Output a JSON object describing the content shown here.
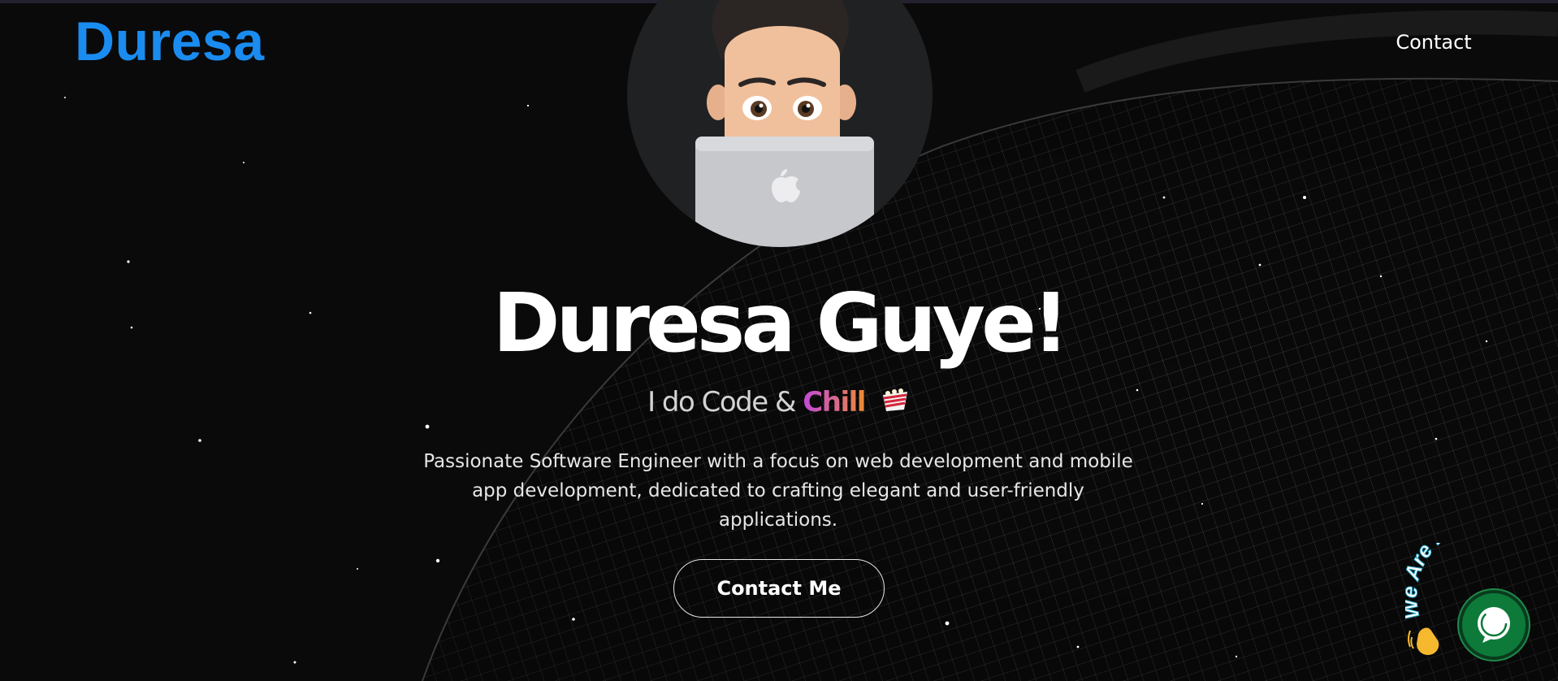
{
  "brand": {
    "logo_text": "Duresa",
    "accent": "#1a8cf0"
  },
  "nav": {
    "contact_label": "Contact"
  },
  "hero": {
    "name": "Duresa Guye!",
    "tagline_prefix": "I do Code & ",
    "tagline_highlight": "Chill",
    "tagline_icon": "popcorn-icon",
    "description": "Passionate Software Engineer with a focus on web development and mobile app development, dedicated to crafting elegant and user-friendly applications.",
    "cta_label": "Contact Me",
    "avatar_icon": "memoji-laptop-avatar"
  },
  "chat_widget": {
    "curved_text": "We Are Here!",
    "wave_icon": "waving-hand-icon",
    "button_icon": "chat-bubble-icon",
    "color": "#0d7a3a"
  },
  "background": {
    "style": "starfield with wireframe globe mesh",
    "color": "#0a0a0b"
  }
}
